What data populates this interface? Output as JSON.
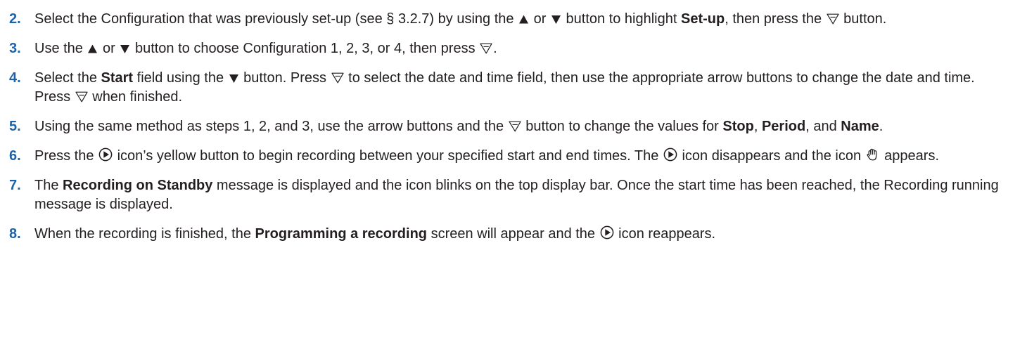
{
  "steps": [
    {
      "num": "2.",
      "parts": [
        {
          "t": "text",
          "v": "Select the Configuration that was previously set-up (see § 3.2.7) by using the "
        },
        {
          "t": "icon",
          "name": "up-arrow-icon"
        },
        {
          "t": "text",
          "v": " or "
        },
        {
          "t": "icon",
          "name": "down-arrow-icon"
        },
        {
          "t": "text",
          "v": " button to highlight "
        },
        {
          "t": "bold",
          "v": "Set-up"
        },
        {
          "t": "text",
          "v": ", then press the "
        },
        {
          "t": "icon",
          "name": "enter-icon"
        },
        {
          "t": "text",
          "v": " button."
        }
      ]
    },
    {
      "num": "3.",
      "parts": [
        {
          "t": "text",
          "v": "Use the "
        },
        {
          "t": "icon",
          "name": "up-arrow-icon"
        },
        {
          "t": "text",
          "v": "  or "
        },
        {
          "t": "icon",
          "name": "down-arrow-icon"
        },
        {
          "t": "text",
          "v": " button to choose Configuration 1, 2, 3, or 4, then press "
        },
        {
          "t": "icon",
          "name": "enter-icon"
        },
        {
          "t": "text",
          "v": "."
        }
      ]
    },
    {
      "num": "4.",
      "parts": [
        {
          "t": "text",
          "v": "Select the "
        },
        {
          "t": "bold",
          "v": "Start"
        },
        {
          "t": "text",
          "v": " field using the "
        },
        {
          "t": "icon",
          "name": "down-arrow-icon"
        },
        {
          "t": "text",
          "v": " button. Press "
        },
        {
          "t": "icon",
          "name": "enter-icon"
        },
        {
          "t": "text",
          "v": " to select the date and time field, then use the appropriate arrow buttons to change the date and time. Press "
        },
        {
          "t": "icon",
          "name": "enter-icon"
        },
        {
          "t": "text",
          "v": " when finished."
        }
      ]
    },
    {
      "num": "5.",
      "parts": [
        {
          "t": "text",
          "v": "Using the same method as steps 1, 2, and 3, use the arrow buttons and the "
        },
        {
          "t": "icon",
          "name": "enter-icon"
        },
        {
          "t": "text",
          "v": " button to change the values for "
        },
        {
          "t": "bold",
          "v": "Stop"
        },
        {
          "t": "text",
          "v": ", "
        },
        {
          "t": "bold",
          "v": "Period"
        },
        {
          "t": "text",
          "v": ", and "
        },
        {
          "t": "bold",
          "v": "Name"
        },
        {
          "t": "text",
          "v": "."
        }
      ]
    },
    {
      "num": "6.",
      "parts": [
        {
          "t": "text",
          "v": "Press the "
        },
        {
          "t": "icon",
          "name": "record-icon"
        },
        {
          "t": "text",
          "v": " icon’s yellow button to begin recording between your specified start and end times. The "
        },
        {
          "t": "icon",
          "name": "record-icon"
        },
        {
          "t": "text",
          "v": " icon disappears and the icon "
        },
        {
          "t": "icon",
          "name": "hand-icon"
        },
        {
          "t": "text",
          "v": " appears."
        }
      ]
    },
    {
      "num": "7.",
      "parts": [
        {
          "t": "text",
          "v": "The "
        },
        {
          "t": "bold",
          "v": "Recording on Standby"
        },
        {
          "t": "text",
          "v": " message is displayed and the icon blinks on the top display bar.  Once the start time has been reached, the Recording running message is displayed."
        }
      ]
    },
    {
      "num": "8.",
      "parts": [
        {
          "t": "text",
          "v": "When the recording is finished, the "
        },
        {
          "t": "bold",
          "v": "Programming a recording"
        },
        {
          "t": "text",
          "v": " screen will appear and the "
        },
        {
          "t": "icon",
          "name": "record-icon"
        },
        {
          "t": "text",
          "v": " icon reappears."
        }
      ]
    }
  ]
}
